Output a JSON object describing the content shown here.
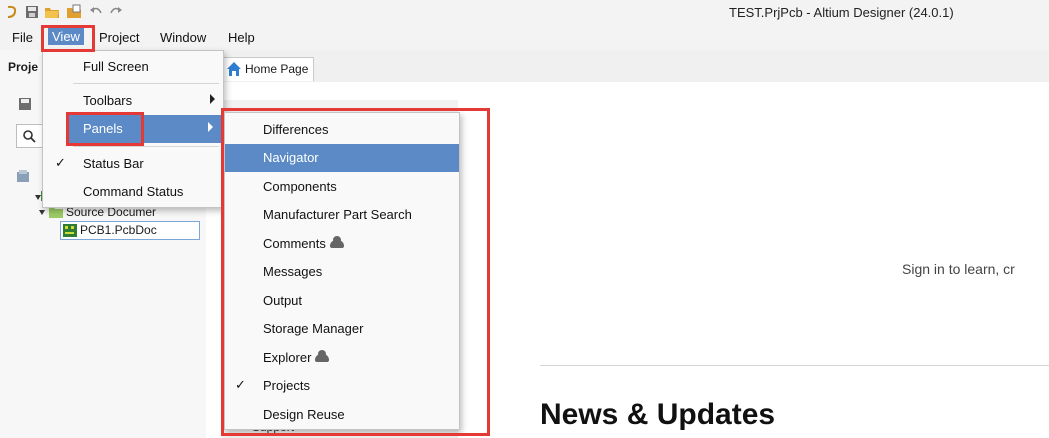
{
  "window": {
    "title": "TEST.PrjPcb - Altium Designer (24.0.1)"
  },
  "quick_access": [
    "app-logo-icon",
    "save-icon",
    "open-icon",
    "open-project-icon",
    "undo-icon",
    "redo-icon"
  ],
  "menubar": [
    {
      "label": "File"
    },
    {
      "label": "View",
      "active": true
    },
    {
      "label": "Project"
    },
    {
      "label": "Window"
    },
    {
      "label": "Help"
    }
  ],
  "left_panel": {
    "tab_label": "Proje",
    "tree": {
      "folder_label": "Source Documer",
      "file_label": "PCB1.PcbDoc"
    }
  },
  "tabs": {
    "home": "Home Page"
  },
  "view_menu": {
    "items": [
      {
        "label": "Full Screen"
      },
      {
        "label": "Toolbars",
        "submenu": true
      },
      {
        "label": "Panels",
        "submenu": true,
        "highlighted": true
      },
      {
        "label": "Status Bar",
        "checked": true
      },
      {
        "label": "Command Status"
      }
    ]
  },
  "panels_menu": {
    "items": [
      {
        "label": "Differences"
      },
      {
        "label": "Navigator",
        "highlighted": true
      },
      {
        "label": "Components"
      },
      {
        "label": "Manufacturer Part Search"
      },
      {
        "label": "Comments",
        "cloud": true
      },
      {
        "label": "Messages"
      },
      {
        "label": "Output"
      },
      {
        "label": "Storage Manager"
      },
      {
        "label": "Explorer",
        "cloud": true
      },
      {
        "label": "Projects",
        "checked": true
      },
      {
        "label": "Design Reuse"
      }
    ]
  },
  "main": {
    "sign_in_text": "Sign in to learn, cr",
    "news_heading": "News & Updates",
    "support_text": "Support"
  },
  "colors": {
    "highlight": "#5b8ac6",
    "annotation_red": "#e53935"
  }
}
